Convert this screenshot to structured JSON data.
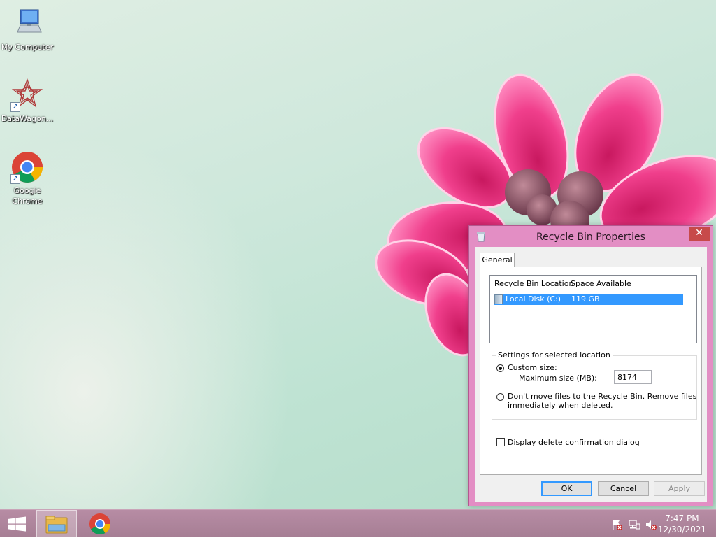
{
  "desktop": {
    "icons": [
      {
        "label": "My Computer",
        "icon": "computer-icon"
      },
      {
        "label": "DataWagon...",
        "icon": "datawagon-icon"
      },
      {
        "label": "Google Chrome",
        "icon": "chrome-icon"
      }
    ]
  },
  "dialog": {
    "title": "Recycle Bin Properties",
    "close_glyph": "✕",
    "tabs": [
      {
        "label": "General"
      }
    ],
    "list": {
      "columns": [
        "Recycle Bin Location",
        "Space Available"
      ],
      "rows": [
        {
          "location": "Local Disk (C:)",
          "space": "119 GB",
          "selected": true
        }
      ]
    },
    "settings": {
      "legend": "Settings for selected location",
      "custom_size_label": "Custom size:",
      "custom_size_checked": true,
      "max_size_label": "Maximum size (MB):",
      "max_size_value": "8174",
      "dont_move_line1": "Don't move files to the Recycle Bin. Remove files",
      "dont_move_line2": "immediately when deleted.",
      "dont_move_checked": false
    },
    "confirm_label": "Display delete confirmation dialog",
    "confirm_checked": false,
    "buttons": {
      "ok": "OK",
      "cancel": "Cancel",
      "apply": "Apply"
    }
  },
  "taskbar": {
    "pinned": [
      "windows-start-icon",
      "file-explorer-icon",
      "chrome-icon"
    ],
    "tray": [
      "action-center-flag-icon",
      "network-icon",
      "volume-muted-icon"
    ],
    "time": "7:47 PM",
    "date": "12/30/2021"
  },
  "colors": {
    "window_frame": "#e38ec4",
    "taskbar": "#b08499",
    "selection": "#3399ff",
    "close_button": "#c74a4a"
  }
}
